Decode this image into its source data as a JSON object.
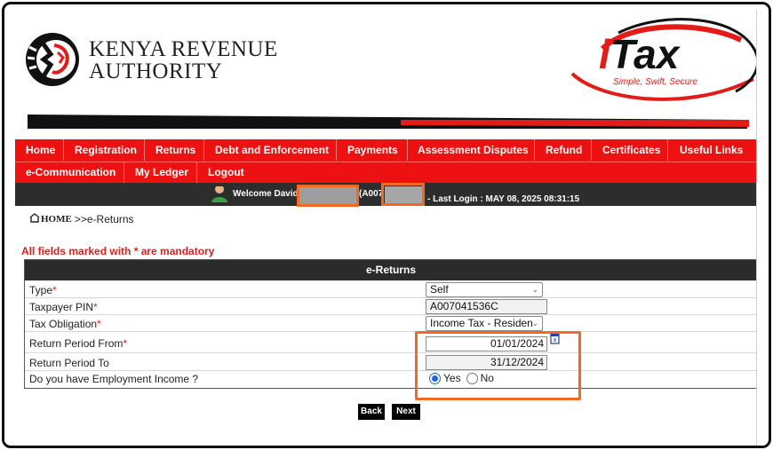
{
  "header": {
    "org_line1": "KENYA REVENUE",
    "org_line2": "AUTHORITY",
    "itax_brand": "iTax",
    "itax_tagline": "Simple, Swift, Secure"
  },
  "nav": {
    "row1": [
      "Home",
      "Registration",
      "Returns",
      "Debt and Enforcement",
      "Payments",
      "Assessment Disputes",
      "Refund",
      "Certificates",
      "Useful Links"
    ],
    "row2": [
      "e-Communication",
      "My Ledger",
      "Logout"
    ]
  },
  "welcome": {
    "prefix": "Welcome David",
    "pin_prefix": "(A007",
    "last_login": "- Last Login : MAY 08, 2025 08:31:15"
  },
  "breadcrumb": {
    "home": "HOME",
    "current": ">>e-Returns"
  },
  "mandatory_note": "All fields marked with * are mandatory",
  "form": {
    "title": "e-Returns",
    "type_label": "Type",
    "type_value": "Self",
    "pin_label": "Taxpayer PIN",
    "pin_value": "A007041536C",
    "obligation_label": "Tax Obligation",
    "obligation_value": "Income Tax - Residen",
    "from_label": "Return Period From",
    "from_value": "01/01/2024",
    "to_label": "Return Period To",
    "to_value": "31/12/2024",
    "employment_label": "Do you have Employment Income ?",
    "yes_label": "Yes",
    "no_label": "No",
    "employment_selected": "Yes",
    "required_mark": "*"
  },
  "buttons": {
    "back": "Back",
    "next": "Next"
  },
  "colors": {
    "nav_red": "#ee1111",
    "dark_bar": "#2d2d2d",
    "highlight": "#f26a21",
    "required": "#e41b17"
  }
}
